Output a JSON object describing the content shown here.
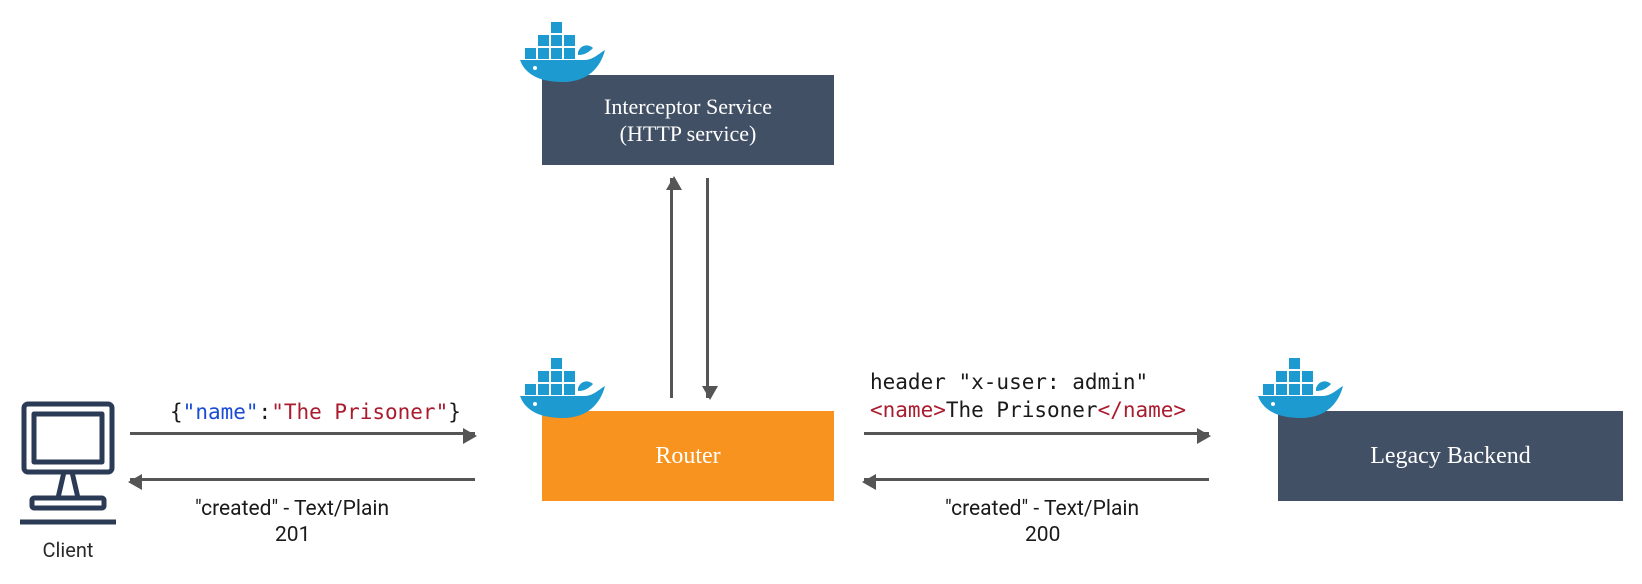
{
  "nodes": {
    "interceptor": {
      "line1": "Interceptor Service",
      "line2": "(HTTP service)"
    },
    "router": {
      "label": "Router"
    },
    "backend": {
      "label": "Legacy Backend"
    },
    "client": {
      "label": "Client"
    }
  },
  "edges": {
    "client_to_router": {
      "payload": {
        "open": "{",
        "key_quote_open": "\"",
        "key": "name",
        "key_quote_close": "\"",
        "colon": ":",
        "val_quote_open": "\"",
        "val": "The Prisoner",
        "val_quote_close": "\"",
        "close": "}"
      }
    },
    "router_to_client": {
      "line1": "\"created\" - Text/Plain",
      "line2": "201"
    },
    "router_to_backend": {
      "header_line": "header \"x-user: admin\"",
      "xml": {
        "open_tag": "<name>",
        "text": "The Prisoner",
        "close_tag": "</name>"
      }
    },
    "backend_to_router": {
      "line1": "\"created\" - Text/Plain",
      "line2": "200"
    }
  },
  "icons": {
    "docker": "docker-whale-icon",
    "client": "desktop-computer-icon"
  },
  "colors": {
    "dark_box": "#425066",
    "orange_box": "#f7931e",
    "arrow": "#555555",
    "docker_blue": "#1d9bd1",
    "json_key": "#1a4bd3",
    "json_str": "#aa1b2e"
  }
}
